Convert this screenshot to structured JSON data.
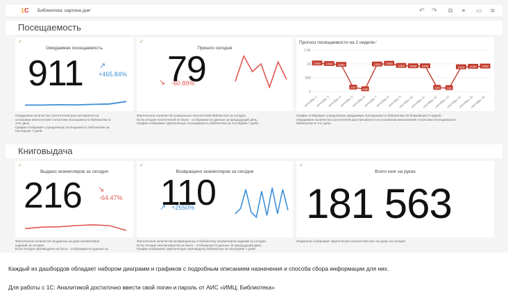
{
  "app": {
    "logo": "1С",
    "title": "Библиотека: картина дня"
  },
  "sections": {
    "attendance": "Посещаемость",
    "books": "Книговыдача"
  },
  "cards": {
    "expected": {
      "title": "Ожидаемая посещаемость",
      "value": "911",
      "delta": "+465.84%",
      "desc": [
        "Ожидаемое количество посетителей рассчитывается на",
        "основании многолетней статистики посещаемости библиотеки в",
        "этот день.",
        "График отображает усредненную посещаемость библиотеки за",
        "последние 7 дней."
      ]
    },
    "today": {
      "title": "Пришло сегодня",
      "value": "79",
      "delta": "-60.89%",
      "desc": [
        "Фактическое количество уникальных посетителей библиотеки за сегодня.",
        "Если сегодня посетителей не было - отображаются данные за предыдущий день.",
        "График отображает фактическую посещаемость библиотеки за последние 7 дней."
      ]
    },
    "issued": {
      "title": "Выдано экземпляров за сегодня",
      "value": "216",
      "delta": "-64.47%",
      "desc": [
        "Фактическое количество выданных на руки экземпляров",
        "изданий за сегодня.",
        "Если сегодня книговыдачи не было - отображаются данные за"
      ]
    },
    "returned": {
      "title": "Возвращено экземпляров за сегодня",
      "value": "110",
      "delta": "+2650%",
      "desc": [
        "Фактическое количество возвращенных в библиотеку экземпляров изданий за сегодня.",
        "Если сегодня книговозвратов не было - отображаются данные за предыдущий день.",
        "График отображает фактическую книговыдачу библиотеки за последние 7 дней."
      ]
    },
    "total": {
      "title": "Всего книг на руках",
      "value": "181 563",
      "desc": [
        "Индикатор отображает фактическое количество книг на руках на сегодня"
      ]
    }
  },
  "forecast": {
    "title": "Прогноз посещаемости на 2 недели",
    "desc": [
      "График отображает усредненную ожидаемую посещаемость библиотеки на ближайшие 2 недели.",
      "Ожидаемое количество посетителей рассчитывается на основании многолетней статистики посещаемости",
      "библиотеки в этот день."
    ]
  },
  "chart_data": {
    "type": "line",
    "title": "Прогноз посещаемости на 2 недели",
    "ylim": [
      0,
      1500
    ],
    "yticks": [
      "1.5K",
      "1K",
      "500",
      "0"
    ],
    "x": [
      "сентябрь 2",
      "сентябрь 3",
      "сентябрь 4",
      "сентябрь 5",
      "сентябрь 6",
      "сентябрь 7",
      "сентябрь 8",
      "сентябрь 9",
      "сентябрь 10",
      "сентябрь 11",
      "сентябрь 12",
      "сентябрь 13",
      "сентябрь 14",
      "сентябрь 15",
      "сентябрь 16"
    ],
    "values": [
      1020,
      1000,
      970,
      150,
      90,
      980,
      1010,
      930,
      920,
      920,
      140,
      130,
      880,
      900,
      910
    ],
    "labels": [
      "1000",
      "1000",
      "1000",
      "100",
      "100",
      "1000",
      "1000",
      "1000",
      "1000",
      "1000",
      "100",
      "100",
      "1000",
      "1000",
      "1000"
    ],
    "grid": true,
    "color": "#c0392b"
  },
  "sparklines": {
    "expected": [
      0.1,
      0.1,
      0.12,
      0.11,
      0.14,
      0.16,
      0.3
    ],
    "today": [
      0.3,
      0.95,
      0.55,
      0.75,
      0.15,
      0.8,
      0.35
    ],
    "issued": [
      0.3,
      0.4,
      0.42,
      0.5,
      0.55,
      0.5,
      0.18
    ],
    "returned": [
      0.2,
      0.35,
      0.9,
      0.25,
      0.1,
      0.85,
      0.15,
      0.95,
      0.2,
      0.9,
      0.3
    ]
  },
  "captions": [
    "Каждый из дашбордов обладает набором диаграмм и графиков с подробным описанием назначения и способа сбора информации для них.",
    "Для работы с 1С: Аналитикой достаточно ввести свой логин и пароль от АИС «ИМЦ: Библиотека»"
  ],
  "colors": {
    "up": "#3d8ed6",
    "down": "#e0554f",
    "line": "#c0392b"
  }
}
